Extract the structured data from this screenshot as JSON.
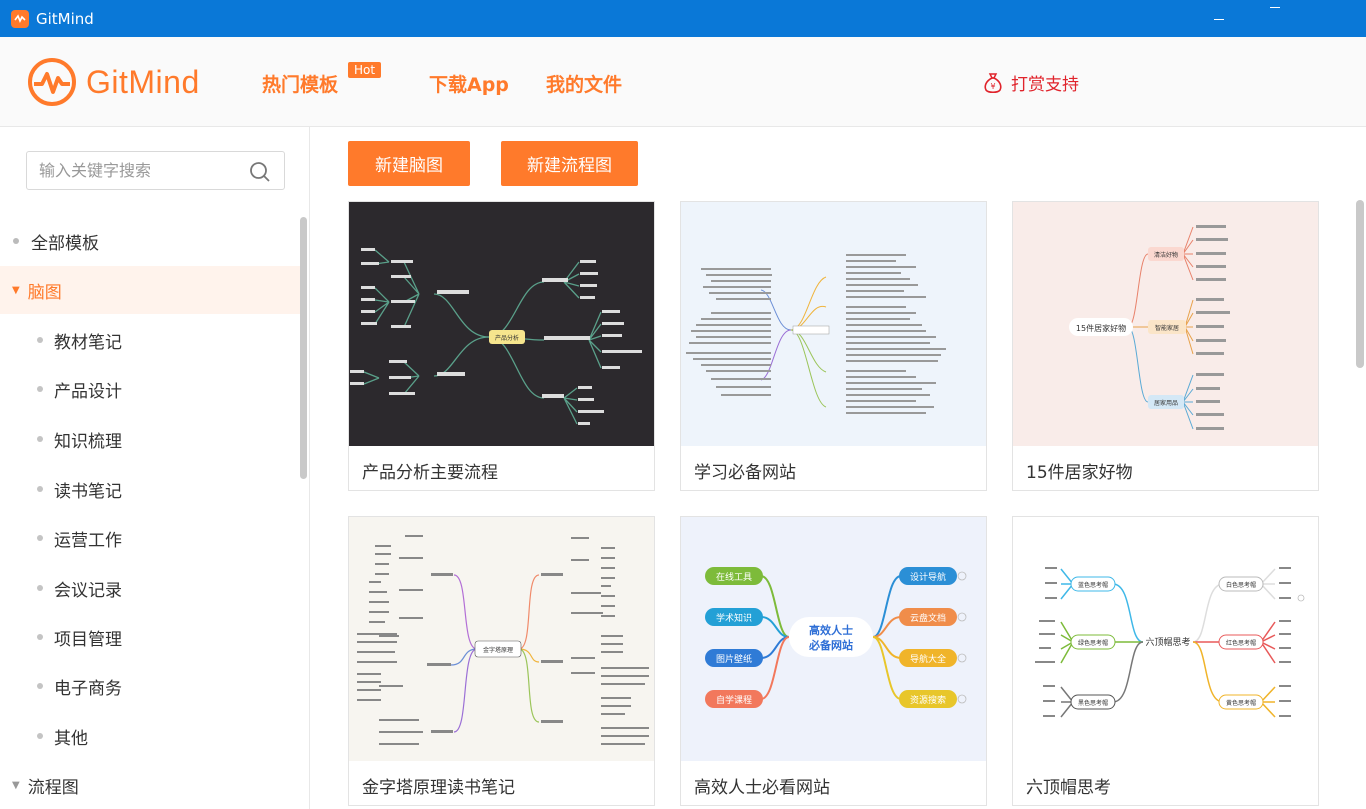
{
  "window": {
    "title": "GitMind"
  },
  "header": {
    "logo_text": "GitMind",
    "nav": {
      "hot": "热门模板",
      "hot_badge": "Hot",
      "download": "下载App",
      "files": "我的文件"
    },
    "donate": "打赏支持"
  },
  "colors": {
    "accent": "#ff7a2b",
    "titlebar": "#0a78d7",
    "donate": "#e0232b"
  },
  "sidebar": {
    "search_placeholder": "输入关键字搜索",
    "categories": [
      "全部模板",
      "脑图",
      "流程图"
    ],
    "sub": [
      "教材笔记",
      "产品设计",
      "知识梳理",
      "读书笔记",
      "运营工作",
      "会议记录",
      "项目管理",
      "电子商务",
      "其他"
    ]
  },
  "main": {
    "buttons": {
      "new_mind": "新建脑图",
      "new_flow": "新建流程图"
    },
    "cards": [
      {
        "title": "产品分析主要流程",
        "center": "产品分析"
      },
      {
        "title": "学习必备网站"
      },
      {
        "title": "15件居家好物",
        "center": "15件居家好物",
        "branches": [
          "清洁好物",
          "智能家居",
          "居家用品"
        ]
      },
      {
        "title": "金字塔原理读书笔记",
        "center": "金字塔原理"
      },
      {
        "title": "高效人士必看网站",
        "center_line1": "高效人士",
        "center_line2": "必备网站",
        "left": [
          "在线工具",
          "学术知识",
          "图片壁纸",
          "自学课程"
        ],
        "right": [
          "设计导航",
          "云盘文档",
          "导航大全",
          "资源搜索"
        ]
      },
      {
        "title": "六顶帽思考",
        "center": "六顶帽思考",
        "left": [
          "蓝色思考帽",
          "绿色思考帽",
          "黑色思考帽"
        ],
        "right": [
          "白色思考帽",
          "红色思考帽",
          "黄色思考帽"
        ]
      }
    ]
  }
}
